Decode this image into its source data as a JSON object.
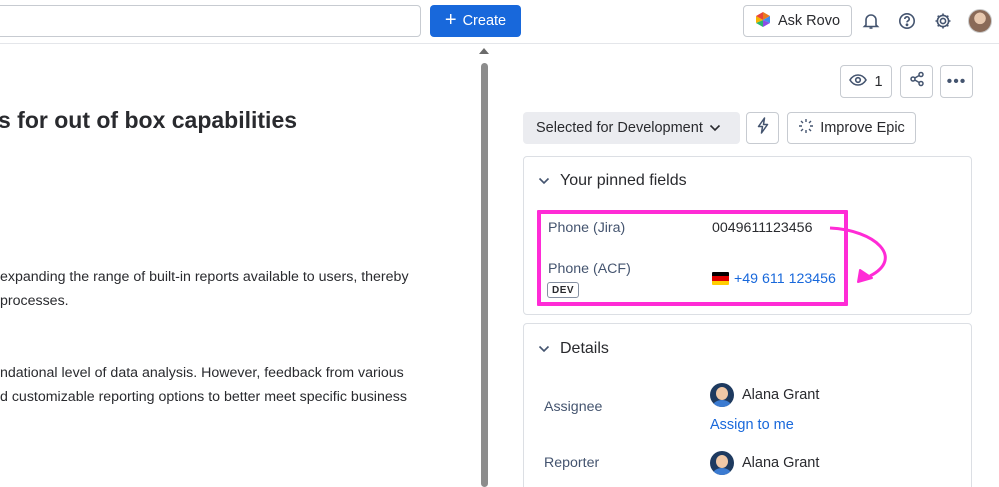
{
  "topbar": {
    "search_placeholder": "",
    "create_label": "Create",
    "rovo_label": "Ask Rovo"
  },
  "description": {
    "title": "s for out of box capabilities",
    "paragraph1": [
      "expanding the range of built-in reports available to users, thereby",
      "processes."
    ],
    "paragraph2": [
      "ndational level of data analysis. However, feedback from various",
      "d customizable reporting options to better meet specific business"
    ]
  },
  "actions": {
    "watch_count": "1",
    "status_label": "Selected for Development",
    "improve_label": "Improve Epic"
  },
  "pinned": {
    "heading": "Your pinned fields",
    "fields": [
      {
        "label": "Phone (Jira)",
        "value": "0049611123456"
      },
      {
        "label": "Phone (ACF)",
        "badge": "DEV",
        "value": "+49 611 123456"
      }
    ]
  },
  "details": {
    "heading": "Details",
    "assignee_label": "Assignee",
    "assignee_name": "Alana Grant",
    "assign_to_me": "Assign to me",
    "reporter_label": "Reporter",
    "reporter_name": "Alana Grant"
  },
  "colors": {
    "brand_blue": "#1868db",
    "highlight": "#ff2bd6",
    "flag_de": [
      "#000000",
      "#dd0000",
      "#ffce00"
    ]
  }
}
